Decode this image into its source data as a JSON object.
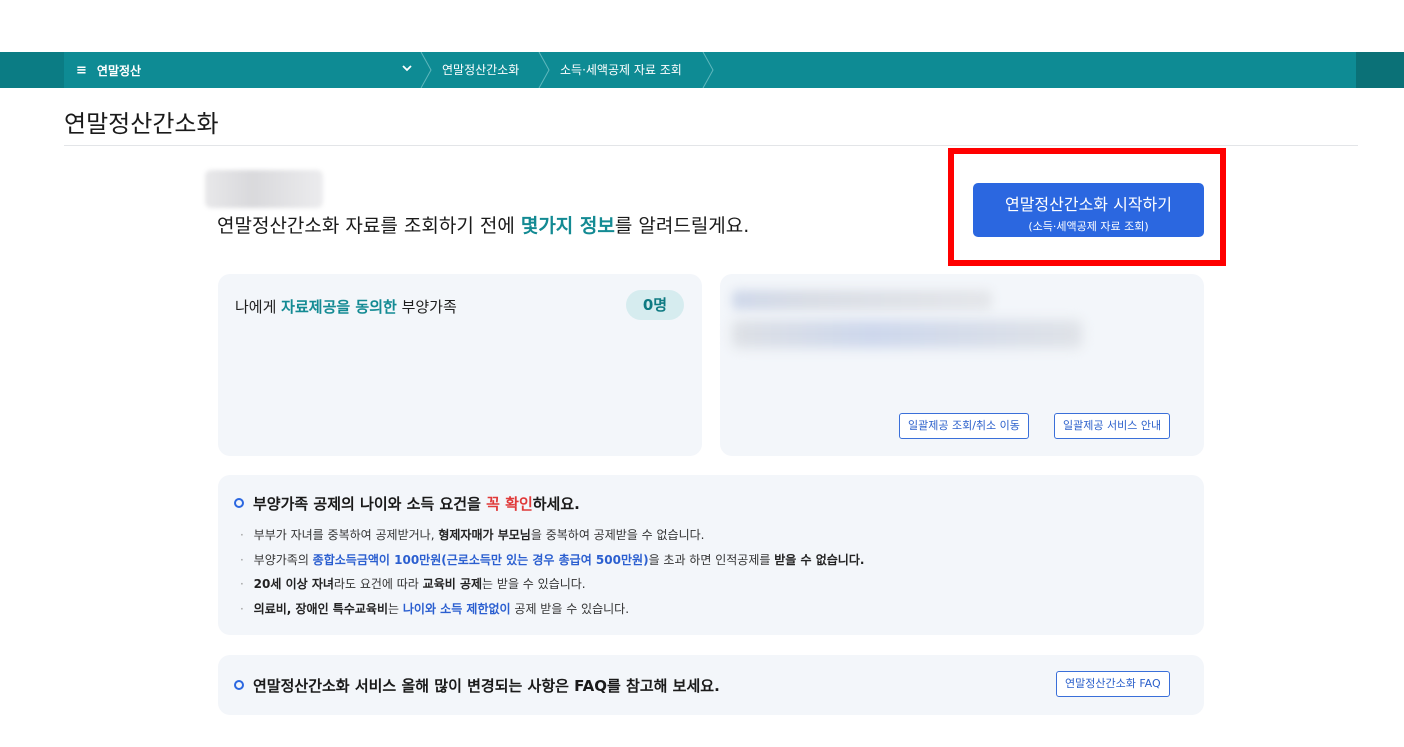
{
  "nav": {
    "menu_label": "연말정산",
    "breadcrumbs": [
      "연말정산간소화",
      "소득·세액공제 자료 조회"
    ]
  },
  "page": {
    "title": "연말정산간소화",
    "intro_pre": "연말정산간소화 자료를 조회하기 전에 ",
    "intro_highlight": "몇가지 정보",
    "intro_post": "를 알려드릴게요."
  },
  "start_button": {
    "label": "연말정산간소화 시작하기",
    "sublabel": "(소득·세액공제 자료 조회)"
  },
  "dependents_card": {
    "label_pre": "나에게 ",
    "label_highlight": "자료제공을 동의한",
    "label_post": " 부양가족",
    "count": "0명"
  },
  "bulk_card": {
    "buttons": [
      "일괄제공 조회/취소 이동",
      "일괄제공 서비스 안내"
    ]
  },
  "info_card": {
    "heading_pre": "부양가족 공제의 나이와 소득 요건을 ",
    "heading_red": "꼭 확인",
    "heading_post": "하세요.",
    "items": [
      {
        "a": "부부가 자녀를 중복하여 공제받거나, ",
        "b": "형제자매가 부모님",
        "c": "을 중복하여 공제받을 수 없습니다."
      },
      {
        "a": "부양가족의 ",
        "b": "종합소득금액이 100만원(근로소득만 있는 경우 총급여 500만원)",
        "c": "을 초과 하면 인적공제를 ",
        "d": "받을 수 없습니다."
      },
      {
        "a": "20세 이상 자녀",
        "b": "라도 요건에 따라 ",
        "c": "교육비 공제",
        "d": "는 받을 수 있습니다."
      },
      {
        "a": "의료비, 장애인 특수교육비",
        "b": "는 ",
        "c": "나이와 소득 제한없이",
        "d": " 공제 받을 수 있습니다."
      }
    ]
  },
  "faq_card": {
    "text": "연말정산간소화 서비스 올해 많이 변경되는 사항은 FAQ를 참고해 보세요.",
    "button": "연말정산간소화 FAQ"
  },
  "colors": {
    "nav_teal": "#0e8b94",
    "accent_teal": "#138a93",
    "primary_blue": "#2b67e0",
    "highlight_frame": "#ff0000",
    "warning_red": "#e03a3a"
  }
}
